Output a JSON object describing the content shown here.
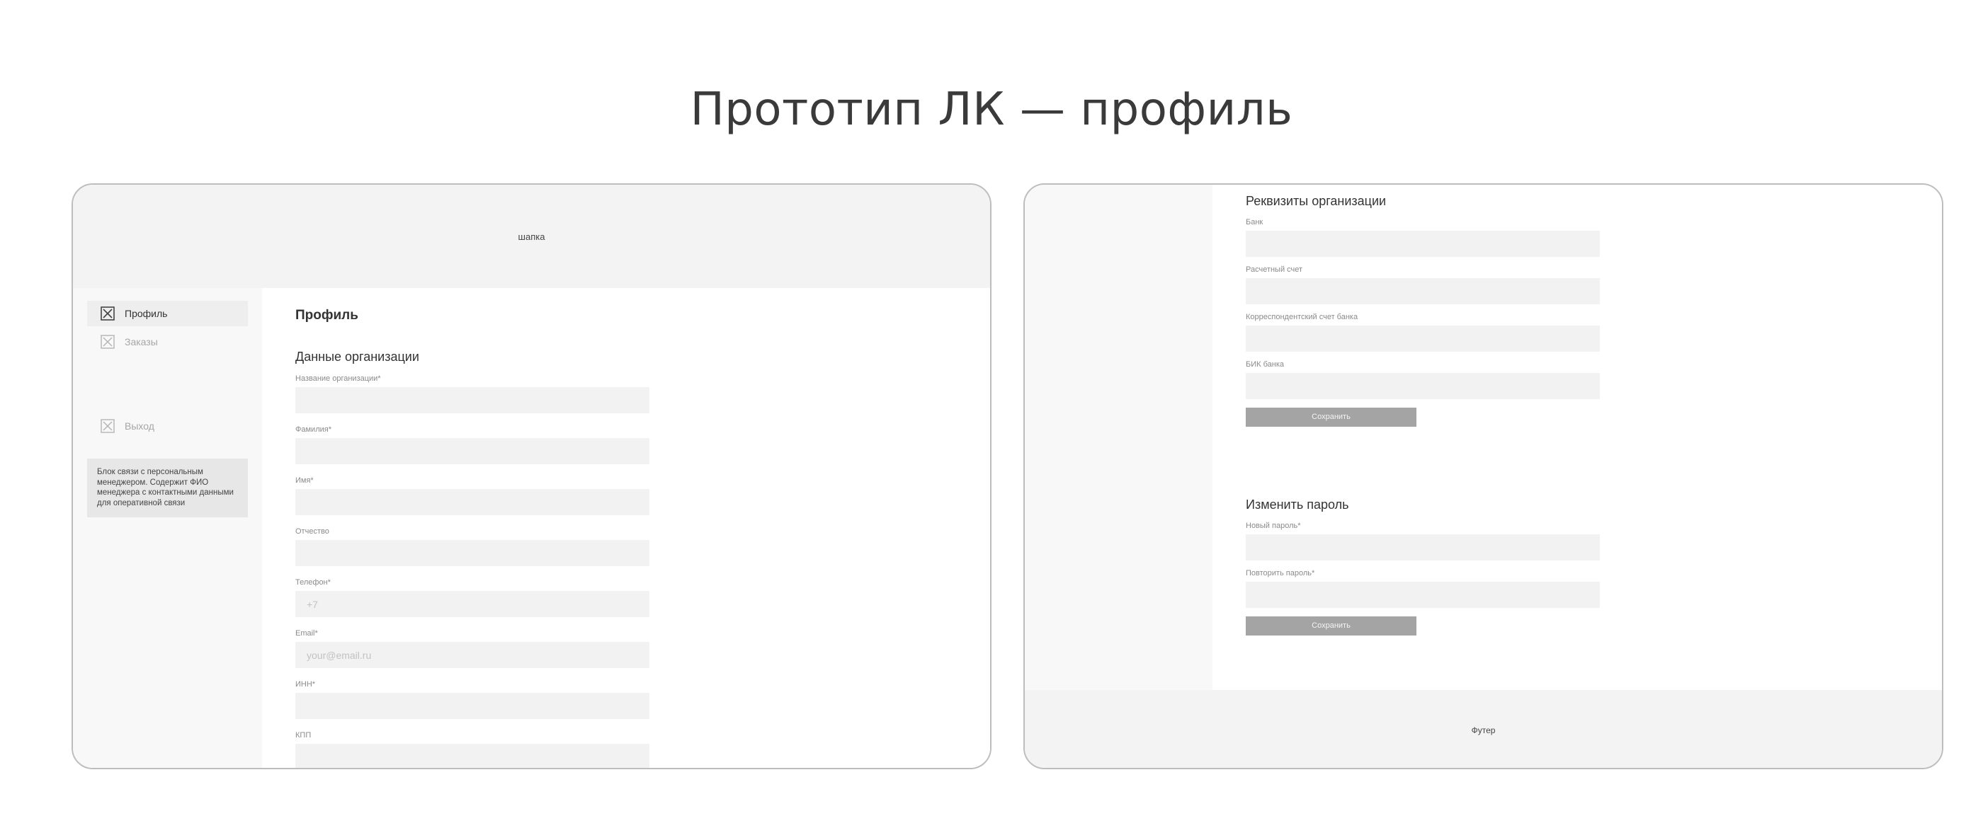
{
  "page": {
    "title": "Прототип ЛК — профиль"
  },
  "left_frame": {
    "header_label": "шапка",
    "sidebar": {
      "items": [
        {
          "label": "Профиль",
          "icon": "checkbox-x-icon",
          "active": true
        },
        {
          "label": "Заказы",
          "icon": "checkbox-x-icon",
          "active": false
        },
        {
          "label": "Выход",
          "icon": "checkbox-x-icon",
          "active": false
        }
      ],
      "manager_block": "Блок связи с персональным менеджером. Содержит ФИО менеджера с контактными данными для оперативной связи"
    },
    "main": {
      "title": "Профиль",
      "section_title": "Данные организации",
      "fields": [
        {
          "label": "Название организации*",
          "value": "",
          "placeholder": ""
        },
        {
          "label": "Фамилия*",
          "value": "",
          "placeholder": ""
        },
        {
          "label": "Имя*",
          "value": "",
          "placeholder": ""
        },
        {
          "label": "Отчество",
          "value": "",
          "placeholder": ""
        },
        {
          "label": "Телефон*",
          "value": "",
          "placeholder": "+7"
        },
        {
          "label": "Email*",
          "value": "",
          "placeholder": "your@email.ru"
        },
        {
          "label": "ИНН*",
          "value": "",
          "placeholder": ""
        },
        {
          "label": "КПП",
          "value": "",
          "placeholder": ""
        }
      ]
    }
  },
  "right_frame": {
    "requisites": {
      "title": "Реквизиты организации",
      "fields": [
        {
          "label": "Банк"
        },
        {
          "label": "Расчетный счет"
        },
        {
          "label": "Корреспондентский счет банка"
        },
        {
          "label": "БИК банка"
        }
      ],
      "save_label": "Сохранить"
    },
    "password": {
      "title": "Изменить пароль",
      "fields": [
        {
          "label": "Новый пароль*"
        },
        {
          "label": "Повторить пароль*"
        }
      ],
      "save_label": "Сохранить"
    },
    "footer_label": "Футер"
  },
  "colors": {
    "save_button": "#a4a4a4",
    "input_bg": "#f2f2f2",
    "header_bg": "#f3f3f3",
    "manager_block_bg": "#e7e7e7"
  }
}
